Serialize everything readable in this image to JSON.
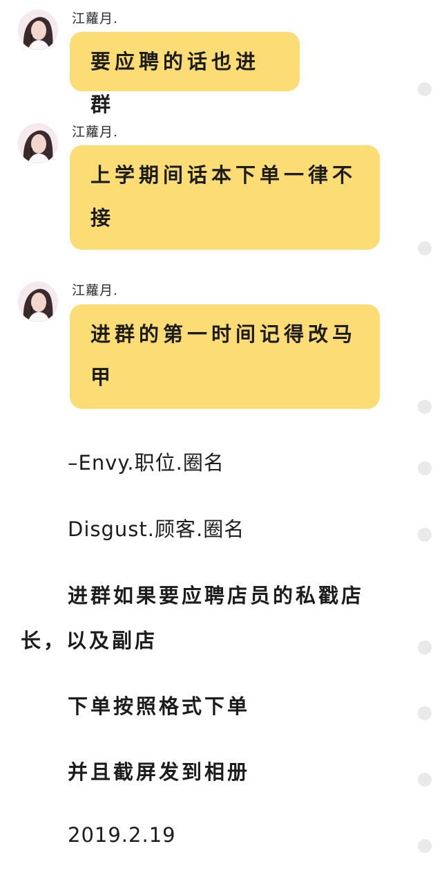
{
  "messages": [
    {
      "sender": "江蘿月.",
      "lines": [
        "要应聘的话也进群"
      ]
    },
    {
      "sender": "江蘿月.",
      "lines": [
        "上学期间话本下单一律不",
        "接"
      ]
    },
    {
      "sender": "江蘿月.",
      "lines": [
        "进群的第一时间记得改马",
        "甲"
      ]
    }
  ],
  "notes": {
    "envy": "–Envy.职位.圈名",
    "disgust": "Disgust.顾客.圈名",
    "recruit_line1": "进群如果要应聘店员的私戳店",
    "recruit_line2": "长，以及副店",
    "order": "下单按照格式下单",
    "screenshot": "并且截屏发到相册",
    "date": "2019.2.19"
  },
  "colors": {
    "bubble": "#fcdc74",
    "background": "#ffffff",
    "dot": "#e9e9e9"
  }
}
